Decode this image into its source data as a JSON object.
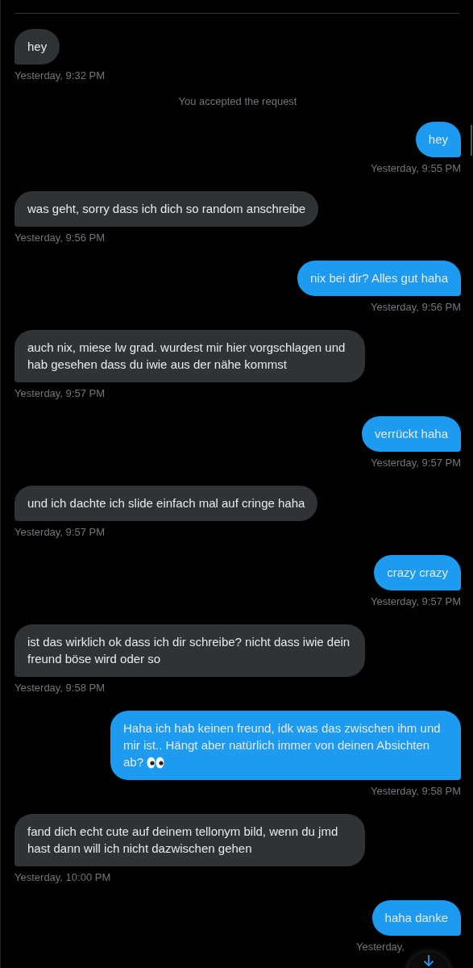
{
  "conversation": [
    {
      "kind": "received",
      "text": "hey",
      "time": "Yesterday, 9:32 PM"
    },
    {
      "kind": "notice",
      "text": "You accepted the request"
    },
    {
      "kind": "sent",
      "text": "hey",
      "time": "Yesterday, 9:55 PM"
    },
    {
      "kind": "received",
      "text": "was geht, sorry dass ich dich so random anschreibe",
      "time": "Yesterday, 9:56 PM"
    },
    {
      "kind": "sent",
      "text": "nix bei dir? Alles gut haha",
      "time": "Yesterday, 9:56 PM"
    },
    {
      "kind": "received",
      "text": "auch nix, miese lw grad. wurdest mir hier vorgschlagen und hab gesehen dass du iwie aus der nähe kommst",
      "time": "Yesterday, 9:57 PM"
    },
    {
      "kind": "sent",
      "text": "verrückt haha",
      "time": "Yesterday, 9:57 PM"
    },
    {
      "kind": "received",
      "text": "und ich dachte ich slide einfach mal auf cringe haha",
      "time": "Yesterday, 9:57 PM"
    },
    {
      "kind": "sent",
      "text": "crazy crazy",
      "time": "Yesterday, 9:57 PM"
    },
    {
      "kind": "received",
      "text": "ist das wirklich ok dass ich dir schreibe? nicht dass iwie dein freund böse wird oder so",
      "time": "Yesterday, 9:58 PM"
    },
    {
      "kind": "sent",
      "text": "Haha ich hab keinen freund, idk was das zwischen ihm und mir ist.. Hängt aber natürlich immer von deinen Absichten ab?",
      "eyes": true,
      "time": "Yesterday, 9:58 PM"
    },
    {
      "kind": "received",
      "text": "fand dich echt cute auf deinem tellonym bild, wenn du jmd hast dann will ich nicht dazwischen gehen",
      "time": "Yesterday, 10:00 PM"
    },
    {
      "kind": "sent",
      "text": "haha danke",
      "time": "Yesterday,"
    }
  ]
}
